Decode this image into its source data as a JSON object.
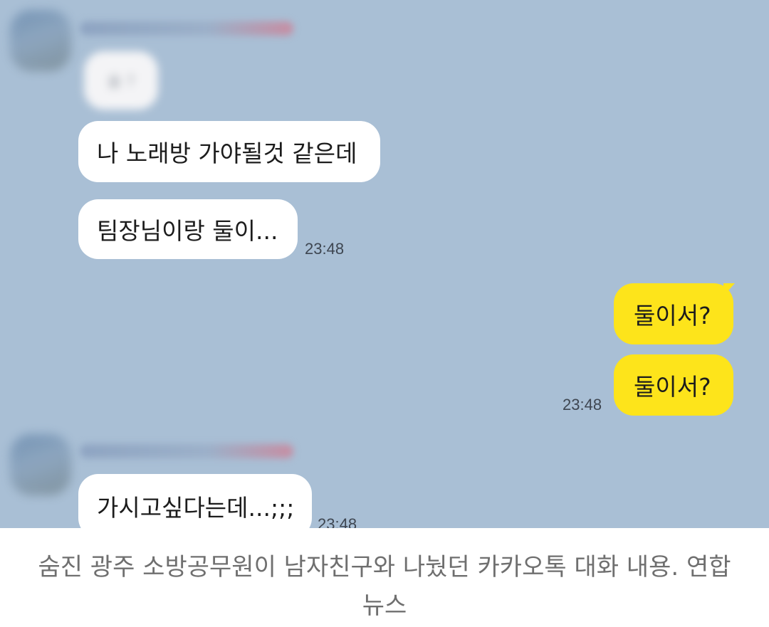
{
  "chat": {
    "background_color": "#a9bfd5",
    "incoming_bubble_color": "#ffffff",
    "outgoing_bubble_color": "#fde41b",
    "messages": [
      {
        "direction": "incoming",
        "text": "술 ?",
        "blurred": true
      },
      {
        "direction": "incoming",
        "text": "나 노래방 가야될것 같은데"
      },
      {
        "direction": "incoming",
        "text": "팀장님이랑 둘이...",
        "time": "23:48"
      },
      {
        "direction": "outgoing",
        "text": "둘이서?"
      },
      {
        "direction": "outgoing",
        "text": "둘이서?",
        "time": "23:48"
      },
      {
        "direction": "incoming",
        "text": "가시고싶다는데...;;;",
        "time": "23:48"
      }
    ]
  },
  "caption": {
    "text": "숨진 광주 소방공무원이 남자친구와 나눴던 카카오톡 대화 내용. 연합뉴스"
  }
}
